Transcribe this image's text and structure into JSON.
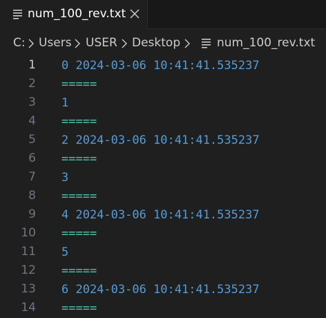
{
  "tab": {
    "label": "num_100_rev.txt",
    "icon": "text-file-icon",
    "close_icon": "close-icon"
  },
  "breadcrumb": {
    "items": [
      "C:",
      "Users",
      "USER",
      "Desktop",
      "num_100_rev.txt"
    ],
    "separator_icon": "chevron-right-icon",
    "file_icon": "text-file-icon"
  },
  "editor": {
    "lines": [
      {
        "number": "1",
        "text": "0 2024-03-06 10:41:41.535237"
      },
      {
        "number": "2",
        "text": "====="
      },
      {
        "number": "3",
        "text": "1"
      },
      {
        "number": "4",
        "text": "====="
      },
      {
        "number": "5",
        "text": "2 2024-03-06 10:41:41.535237"
      },
      {
        "number": "6",
        "text": "====="
      },
      {
        "number": "7",
        "text": "3"
      },
      {
        "number": "8",
        "text": "====="
      },
      {
        "number": "9",
        "text": "4 2024-03-06 10:41:41.535237"
      },
      {
        "number": "10",
        "text": "====="
      },
      {
        "number": "11",
        "text": "5"
      },
      {
        "number": "12",
        "text": "====="
      },
      {
        "number": "13",
        "text": "6 2024-03-06 10:41:41.535237"
      },
      {
        "number": "14",
        "text": "====="
      }
    ]
  },
  "colors": {
    "background": "#1f1f1f",
    "text_value": "#569cd6",
    "separator": "#4ec9b0",
    "line_number": "#6e7681",
    "line_number_active": "#cccccc"
  }
}
